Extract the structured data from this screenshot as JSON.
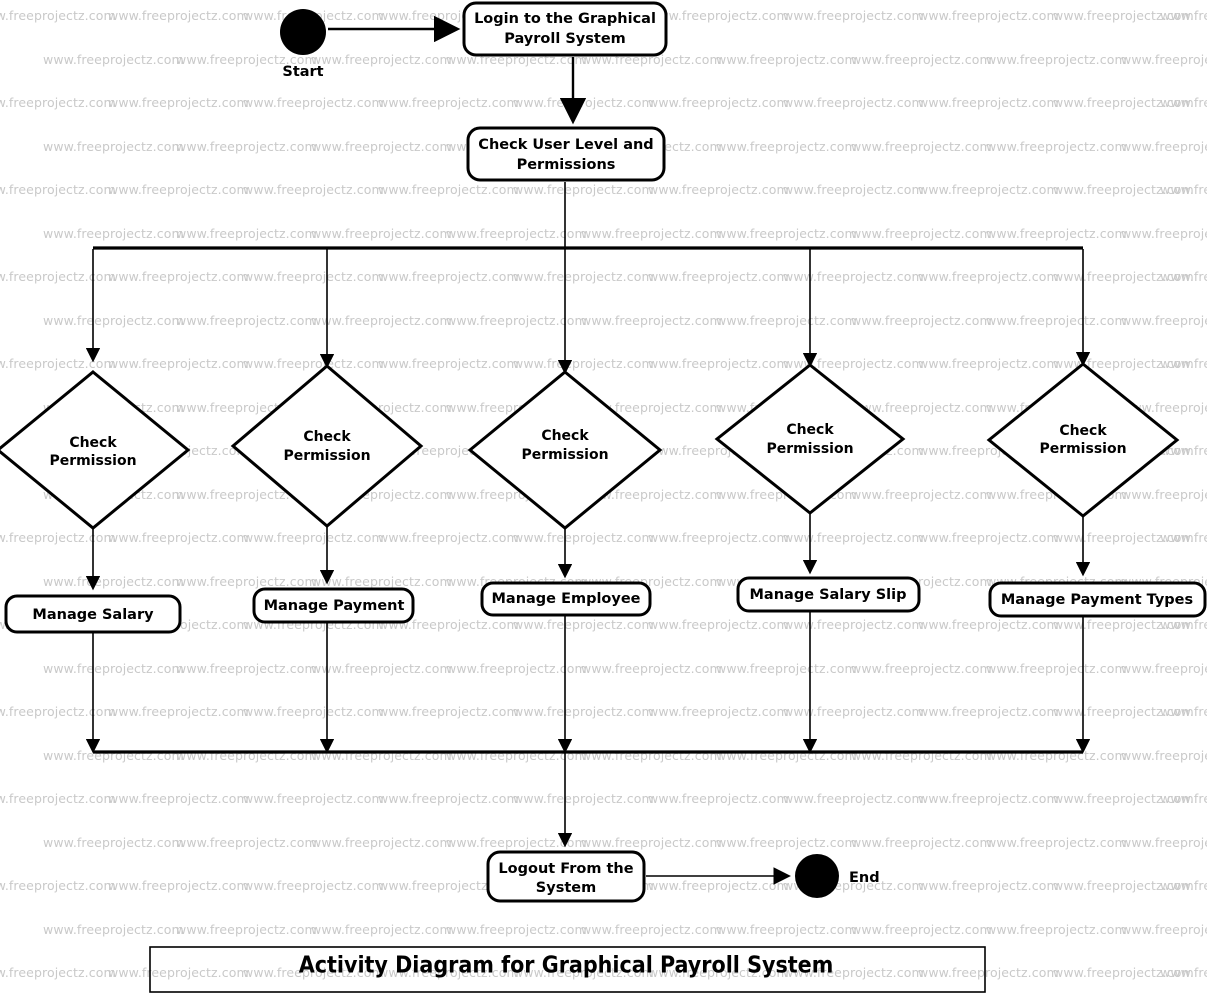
{
  "diagram": {
    "title": "Activity Diagram for Graphical Payroll System",
    "watermark_text": "www.freeprojectz.com",
    "colors": {
      "stroke": "#000000",
      "fill": "#ffffff",
      "watermark": "#c9c9c9",
      "background": "#ffffff"
    }
  },
  "nodes": {
    "start": {
      "label": "Start",
      "type": "initial-node"
    },
    "end": {
      "label": "End",
      "type": "final-node"
    },
    "login": {
      "line1": "Login to the Graphical",
      "line2": "Payroll System",
      "type": "activity"
    },
    "check_user": {
      "line1": "Check User Level and",
      "line2": "Permissions",
      "type": "activity"
    },
    "logout": {
      "line1": "Logout From the",
      "line2": "System",
      "type": "activity"
    }
  },
  "branches": [
    {
      "decision": {
        "line1": "Check",
        "line2": "Permission"
      },
      "activity": "Manage Salary"
    },
    {
      "decision": {
        "line1": "Check",
        "line2": "Permission"
      },
      "activity": "Manage Payment"
    },
    {
      "decision": {
        "line1": "Check",
        "line2": "Permission"
      },
      "activity": "Manage Employee"
    },
    {
      "decision": {
        "line1": "Check",
        "line2": "Permission"
      },
      "activity": "Manage Salary Slip"
    },
    {
      "decision": {
        "line1": "Check",
        "line2": "Permission"
      },
      "activity": "Manage Payment Types"
    }
  ]
}
